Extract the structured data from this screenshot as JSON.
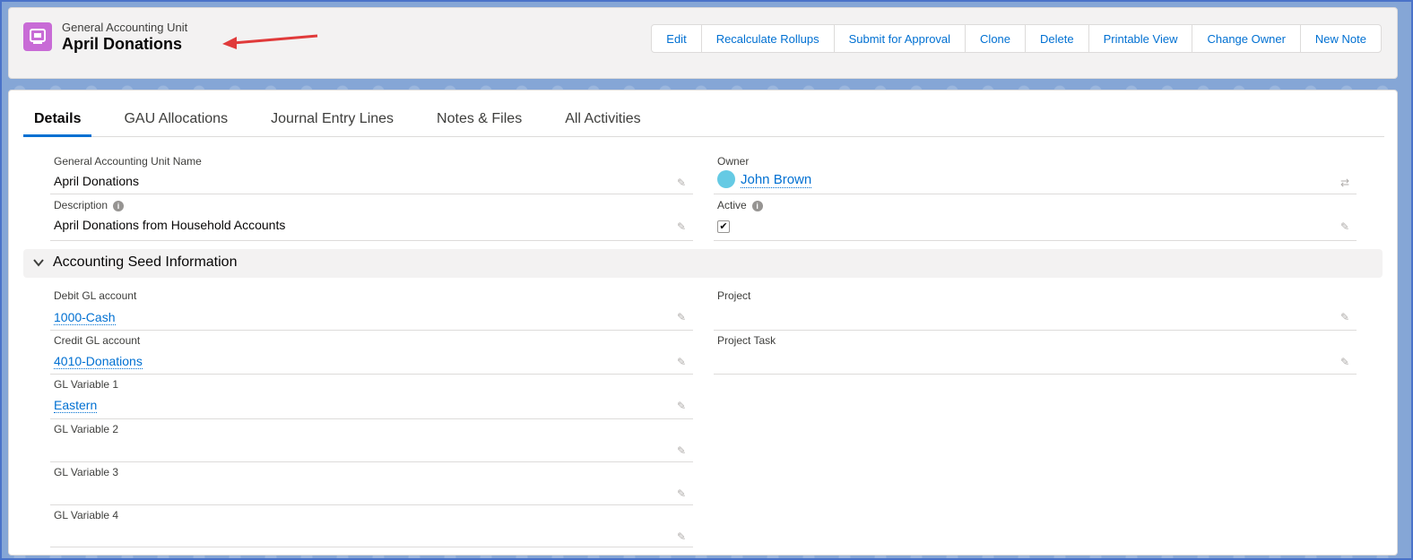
{
  "header": {
    "object_type": "General Accounting Unit",
    "record_name": "April Donations",
    "buttons": [
      "Edit",
      "Recalculate Rollups",
      "Submit for Approval",
      "Clone",
      "Delete",
      "Printable View",
      "Change Owner",
      "New Note"
    ]
  },
  "tabs": [
    "Details",
    "GAU Allocations",
    "Journal Entry Lines",
    "Notes & Files",
    "All Activities"
  ],
  "fields": {
    "gau_name": {
      "label": "General Accounting Unit Name",
      "value": "April Donations"
    },
    "owner": {
      "label": "Owner",
      "value": "John Brown"
    },
    "description": {
      "label": "Description",
      "value": "April Donations from Household Accounts"
    },
    "active": {
      "label": "Active",
      "checked": true
    }
  },
  "section": {
    "title": "Accounting Seed Information",
    "fields": {
      "debit_gl": {
        "label": "Debit GL account",
        "value": "1000-Cash"
      },
      "project": {
        "label": "Project",
        "value": ""
      },
      "credit_gl": {
        "label": "Credit GL account",
        "value": "4010-Donations"
      },
      "project_task": {
        "label": "Project Task",
        "value": ""
      },
      "gl_var1": {
        "label": "GL Variable 1",
        "value": "Eastern"
      },
      "gl_var2": {
        "label": "GL Variable 2",
        "value": ""
      },
      "gl_var3": {
        "label": "GL Variable 3",
        "value": ""
      },
      "gl_var4": {
        "label": "GL Variable 4",
        "value": ""
      }
    }
  },
  "colors": {
    "accent": "#0070d2",
    "object_icon": "#c86bd6",
    "annotation_arrow": "#e03a3a"
  }
}
